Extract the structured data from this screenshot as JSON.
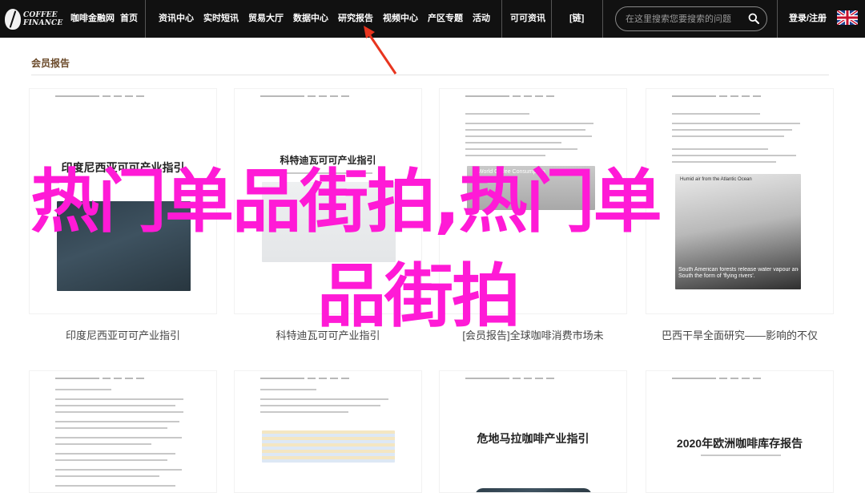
{
  "header": {
    "logo_line1": "COFFEE",
    "logo_line2": "FINANCE",
    "nav": [
      "咖啡金融网",
      "首页",
      "资讯中心",
      "实时短讯",
      "贸易大厅",
      "数据中心",
      "研究报告",
      "视频中心",
      "产区专题",
      "活动",
      "可可资讯",
      "[链]"
    ],
    "search_placeholder": "在这里搜索您要搜索的问题",
    "login_label": "登录/注册",
    "icons": {
      "search": "search-icon",
      "flag": "uk-flag-icon",
      "logo": "coffee-bean-logo-icon"
    }
  },
  "section": {
    "title": "会员报告"
  },
  "cards": [
    {
      "doc_title": "印度尼西亚可可产业指引",
      "caption": "印度尼西亚可可产业指引"
    },
    {
      "doc_title": "科特迪瓦可可产业指引",
      "caption": "科特迪瓦可可产业指引"
    },
    {
      "doc_title": "World Coffee Consumption",
      "caption": "[会员报告]全球咖啡消费市场未"
    },
    {
      "doc_title": "Humid air from the Atlantic Ocean",
      "map_caption_line1": "South American forests release water vapour and their flows",
      "map_caption_line2": "South the form of 'flying rivers'.",
      "caption": "巴西干旱全面研究——影响的不仅"
    },
    {
      "doc_title": "",
      "caption": ""
    },
    {
      "doc_title": "",
      "caption": ""
    },
    {
      "doc_title": "危地马拉咖啡产业指引",
      "caption": ""
    },
    {
      "doc_title": "2020年欧洲咖啡库存报告",
      "caption": ""
    }
  ],
  "overlay": {
    "line1": "热门单品街拍,热门单",
    "line2": "品街拍"
  },
  "colors": {
    "nav_bg": "#111111",
    "accent_title": "#6b4a2a",
    "overlay": "#ff1ad6",
    "arrow": "#e8351f"
  }
}
